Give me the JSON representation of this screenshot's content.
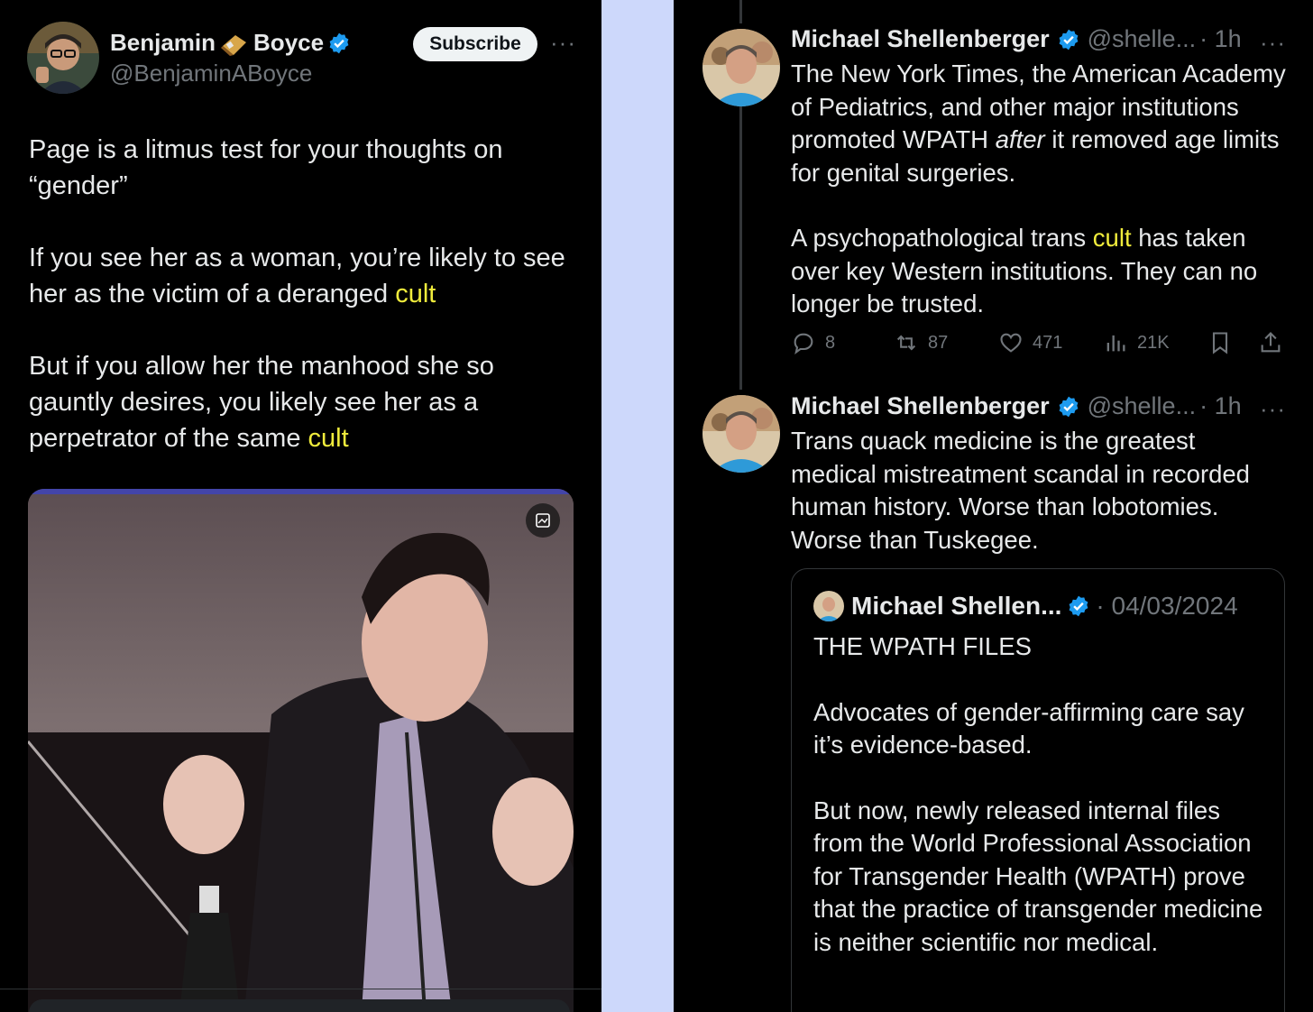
{
  "left_post": {
    "author_first": "Benjamin",
    "author_last": "Boyce",
    "handle": "@BenjaminABoyce",
    "subscribe_label": "Subscribe",
    "more_label": "···",
    "paragraphs": [
      {
        "before": "Page is a litmus test for your thoughts on “gender”",
        "highlight": "",
        "after": ""
      },
      {
        "before": "If you see her as a woman, you’re likely to see her as the victim of a deranged ",
        "highlight": "cult",
        "after": ""
      },
      {
        "before": "But if you allow her the manhood she so gauntly desires, you likely see her as a perpetrator of the same ",
        "highlight": "cult",
        "after": ""
      }
    ]
  },
  "right_thread": {
    "tweet1": {
      "name": "Michael Shellenberger",
      "handle": "@shelle...",
      "time": "· 1h",
      "more_label": "···",
      "p1_before": "The New York Times, the American Academy of Pediatrics, and other major institutions promoted WPATH ",
      "p1_italic": "after",
      "p1_after": " it removed age limits for genital surgeries.",
      "p2_before": "A psychopathological trans ",
      "p2_highlight": "cult",
      "p2_after": " has taken over key Western institutions. They can no longer be trusted.",
      "replies": "8",
      "reposts": "87",
      "likes": "471",
      "views": "21K"
    },
    "tweet2": {
      "name": "Michael Shellenberger",
      "handle": "@shelle...",
      "time": "· 1h",
      "more_label": "···",
      "text": "Trans quack medicine is the greatest medical mistreatment scandal in recorded human history. Worse than lobotomies. Worse than Tuskegee."
    },
    "quote": {
      "name": "Michael Shellen...",
      "date": "· 04/03/2024",
      "paragraphs": [
        "THE WPATH FILES",
        "Advocates of gender-affirming care say it’s evidence-based.",
        "But now, newly released internal files from the World Professional Association for Transgender Health (WPATH) prove that the practice of transgender medicine is neither scientific nor medical."
      ]
    }
  },
  "colors": {
    "background": "#000000",
    "divider": "#cdd8fb",
    "highlight": "#f0ec3c",
    "verified": "#1d9bf0",
    "muted": "#71767b"
  }
}
